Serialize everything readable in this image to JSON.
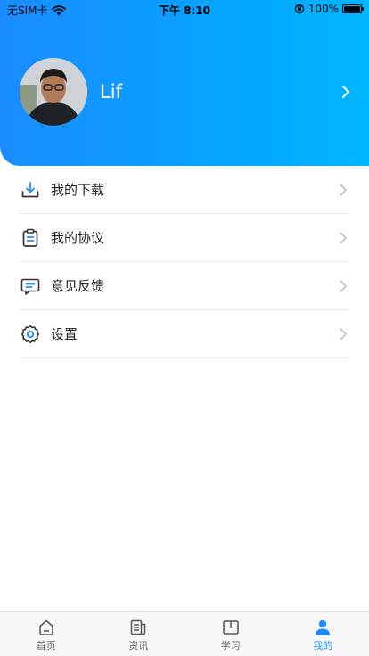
{
  "status_bar": {
    "carrier": "无SIM卡",
    "time": "下午 8:10",
    "battery": "100%"
  },
  "profile": {
    "username": "Lif"
  },
  "menu": {
    "items": [
      {
        "label": "我的下载",
        "icon": "download-icon"
      },
      {
        "label": "我的协议",
        "icon": "clipboard-icon"
      },
      {
        "label": "意见反馈",
        "icon": "feedback-icon"
      },
      {
        "label": "设置",
        "icon": "gear-icon"
      }
    ]
  },
  "tabbar": {
    "items": [
      {
        "label": "首页",
        "icon": "home-icon"
      },
      {
        "label": "资讯",
        "icon": "news-icon"
      },
      {
        "label": "学习",
        "icon": "book-icon"
      },
      {
        "label": "我的",
        "icon": "person-icon"
      }
    ],
    "active_index": 3
  },
  "colors": {
    "accent": "#1a8cff",
    "header_gradient_start": "#1a8cff",
    "header_gradient_end": "#00b6ff"
  }
}
